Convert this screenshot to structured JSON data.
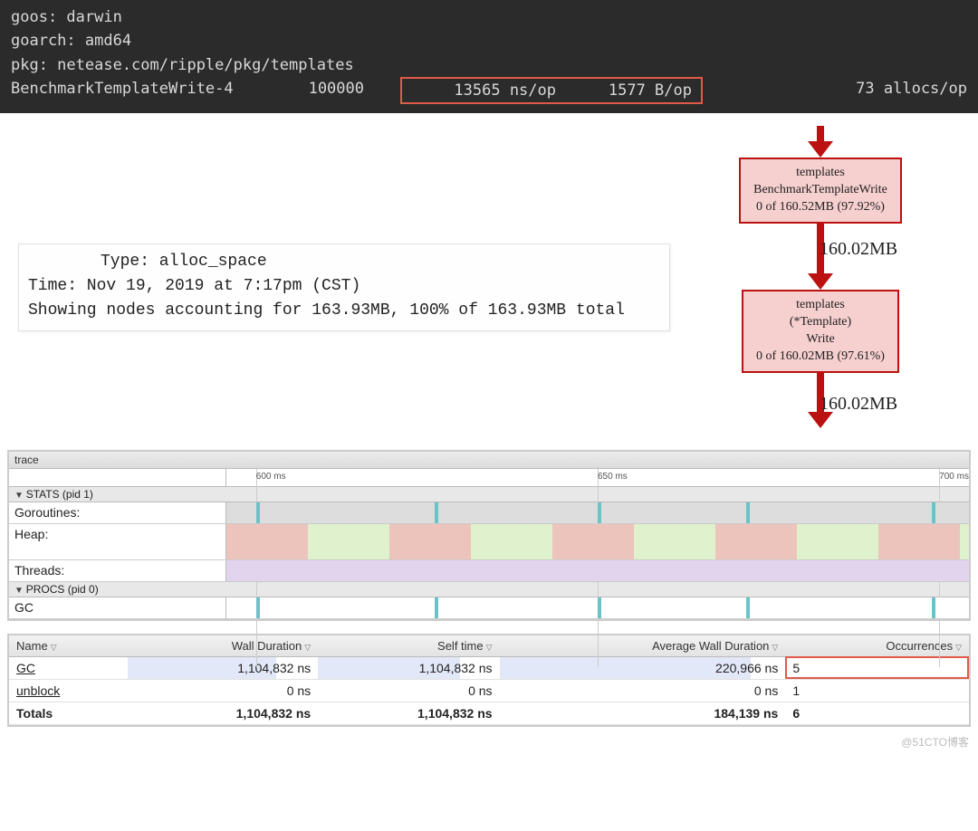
{
  "terminal": {
    "line1": "goos: darwin",
    "line2": "goarch: amd64",
    "line3": "pkg: netease.com/ripple/pkg/templates",
    "bench": {
      "name": "BenchmarkTemplateWrite-4",
      "iters": "100000",
      "ns_per_op": "13565 ns/op",
      "b_per_op": "1577 B/op",
      "allocs_per_op": "73 allocs/op"
    }
  },
  "pprof": {
    "type_line": "Type: alloc_space",
    "time_line": "Time: Nov 19, 2019 at 7:17pm (CST)",
    "showing_line": "Showing nodes accounting for 163.93MB, 100% of 163.93MB total"
  },
  "graph": {
    "node1": "templates\nBenchmarkTemplateWrite\n0 of 160.52MB (97.92%)",
    "edge1": "160.02MB",
    "node2": "templates\n(*Template)\nWrite\n0 of 160.02MB (97.61%)",
    "edge2": "160.02MB"
  },
  "trace": {
    "header": "trace",
    "timeline": {
      "t1": "600 ms",
      "t2": "650 ms",
      "t3": "700 ms"
    },
    "stats_section": "STATS (pid 1)",
    "rows": {
      "goroutines": "Goroutines:",
      "heap": "Heap:",
      "threads": "Threads:"
    },
    "procs_section": "PROCS (pid 0)",
    "gc": "GC"
  },
  "summary": {
    "columns": {
      "name": "Name",
      "wall": "Wall Duration",
      "self": "Self time",
      "avg": "Average Wall Duration",
      "occ": "Occurrences"
    },
    "rows": [
      {
        "name": "GC",
        "wall": "1,104,832 ns",
        "self": "1,104,832 ns",
        "avg": "220,966 ns",
        "occ": "5"
      },
      {
        "name": "unblock",
        "wall": "0 ns",
        "self": "0 ns",
        "avg": "0 ns",
        "occ": "1"
      }
    ],
    "totals": {
      "name": "Totals",
      "wall": "1,104,832 ns",
      "self": "1,104,832 ns",
      "avg": "184,139 ns",
      "occ": "6"
    }
  },
  "watermark": "@51CTO博客",
  "chart_data": [
    {
      "type": "bar",
      "title": "Benchmark result",
      "categories": [
        "ns/op",
        "B/op",
        "allocs/op"
      ],
      "values": [
        13565,
        1577,
        73
      ],
      "iterations": 100000
    },
    {
      "type": "table",
      "title": "pprof call graph (alloc_space)",
      "series": [
        {
          "name": "templates.BenchmarkTemplateWrite",
          "flat_mb": 0,
          "cum_mb": 160.52,
          "cum_pct": 97.92
        },
        {
          "name": "templates.(*Template).Write",
          "flat_mb": 0,
          "cum_mb": 160.02,
          "cum_pct": 97.61
        }
      ],
      "edge_mb": 160.02,
      "total_mb": 163.93
    },
    {
      "type": "table",
      "title": "Trace summary",
      "columns": [
        "Name",
        "Wall Duration ns",
        "Self time ns",
        "Average Wall Duration ns",
        "Occurrences"
      ],
      "rows": [
        [
          "GC",
          1104832,
          1104832,
          220966,
          5
        ],
        [
          "unblock",
          0,
          0,
          0,
          1
        ],
        [
          "Totals",
          1104832,
          1104832,
          184139,
          6
        ]
      ]
    }
  ]
}
